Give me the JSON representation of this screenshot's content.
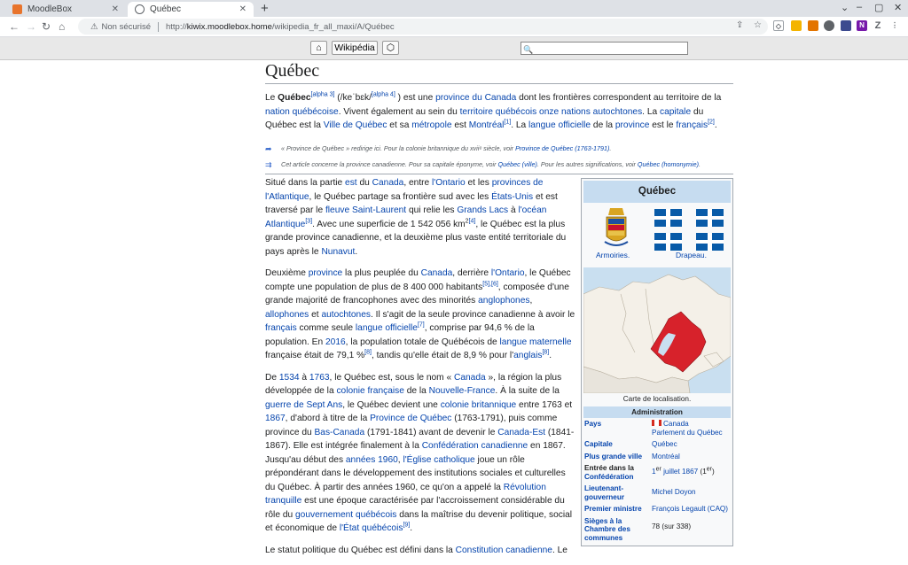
{
  "browser": {
    "tabs": [
      {
        "title": "MoodleBox",
        "active": false
      },
      {
        "title": "Québec",
        "active": true
      }
    ],
    "security_text": "Non sécurisé",
    "url_scheme": "http://",
    "url_host": "kiwix.moodlebox.home",
    "url_path": "/wikipedia_fr_all_maxi/A/Québec"
  },
  "kiwix": {
    "home_icon": "⌂",
    "title_button": "Wikipédia",
    "random_icon": "⬡",
    "search_placeholder": "🔍"
  },
  "article": {
    "title": "Québec",
    "intro": {
      "t1": "Le ",
      "name": "Québec",
      "sup1": "[alpha 3]",
      "t2": " (/ke",
      "ipa": "ˈ",
      "t3": "bɛk/",
      "sup2": "[alpha 4]",
      "t4": " ) est une ",
      "l1": "province du Canada",
      "t5": " dont les frontières correspondent au territoire de la ",
      "l2": "nation québécoise",
      "t6": ". Vivent également au sein du ",
      "l3": "territoire québécois onze nations autochtones",
      "t7": ". La ",
      "l4": "capitale",
      "t8": " du Québec est la ",
      "l5": "Ville de Québec",
      "t9": " et sa ",
      "l6": "métropole",
      "t10": " est ",
      "l7": "Montréal",
      "sup3": "[1]",
      "t11": ". La ",
      "l8": "langue officielle",
      "t12": " de la ",
      "l9": "province",
      "t13": " est le ",
      "l10": "français",
      "sup4": "[2]",
      "t14": "."
    },
    "hatnote1": {
      "t1": "« Province de Québec » redirige ici. Pour la colonie britannique du xviiᵉ siècle, voir ",
      "link": "Province de Québec (1763-1791)",
      "t2": "."
    },
    "hatnote2": {
      "t1": "Cet article concerne la province canadienne. Pour sa capitale éponyme, voir ",
      "l1": "Québec (ville)",
      "t2": ". Pour les autres significations, voir ",
      "l2": "Québec (homonymie)",
      "t3": "."
    },
    "p1": {
      "t1": "Situé dans la partie ",
      "l1": "est",
      "t2": " du ",
      "l2": "Canada",
      "t3": ", entre ",
      "l3": "l'Ontario",
      "t4": " et les ",
      "l4": "provinces de l'Atlantique",
      "t5": ", le Québec partage sa frontière sud avec les ",
      "l5": "États-Unis",
      "t6": " et est traversé par le ",
      "l6": "fleuve Saint-Laurent",
      "t7": " qui relie les ",
      "l7": "Grands Lacs",
      "t8": " à ",
      "l8": "l'océan Atlantique",
      "sup1": "[3]",
      "t9": ". Avec une superficie de 1 542 056 km",
      "sup2": "2",
      "sup3": "[4]",
      "t10": ", le Québec est la plus grande province canadienne, et la deuxième plus vaste entité territoriale du pays après le ",
      "l9": "Nunavut",
      "t11": "."
    },
    "p2": {
      "t1": "Deuxième ",
      "l1": "province",
      "t2": " la plus peuplée du ",
      "l2": "Canada",
      "t3": ", derrière ",
      "l3": "l'Ontario",
      "t4": ", le Québec compte une population de plus de 8 400 000 habitants",
      "sup1": "[5],[6]",
      "t5": ", composée d'une grande majorité de francophones avec des minorités ",
      "l4": "anglophones",
      "t6": ", ",
      "l5": "allophones",
      "t7": " et ",
      "l6": "autochtones",
      "t8": ". Il s'agit de la seule province canadienne à avoir le ",
      "l7": "français",
      "t9": " comme seule ",
      "l8": "langue officielle",
      "sup2": "[7]",
      "t10": ", comprise par 94,6 % de la population. En ",
      "l9": "2016",
      "t11": ", la population totale de Québécois de ",
      "l10": "langue maternelle",
      "t12": " française était de 79,1 %",
      "sup3": "[8]",
      "t13": ", tandis qu'elle était de 8,9 % pour l'",
      "l11": "anglais",
      "sup4": "[8]",
      "t14": "."
    },
    "p3": {
      "t1": "De ",
      "l1": "1534",
      "t2": " à ",
      "l2": "1763",
      "t3": ", le Québec est, sous le nom « ",
      "l3": "Canada",
      "t4": " », la région la plus développée de la ",
      "l4": "colonie française",
      "t5": " de la ",
      "l5": "Nouvelle-France",
      "t6": ". À la suite de la ",
      "l6": "guerre de Sept Ans",
      "t7": ", le Québec devient une ",
      "l7": "colonie britannique",
      "t8": " entre 1763 et ",
      "l8": "1867",
      "t9": ", d'abord à titre de la ",
      "l9": "Province de Québec",
      "t10": " (1763-1791), puis comme province du ",
      "l10": "Bas-Canada",
      "t11": " (1791-1841) avant de devenir le ",
      "l11": "Canada-Est",
      "t12": " (1841-1867). Elle est intégrée finalement à la ",
      "l12": "Confédération canadienne",
      "t13": " en 1867. Jusqu'au début des ",
      "l13": "années 1960",
      "t14": ", ",
      "l14": "l'Église catholique",
      "t15": " joue un rôle prépondérant dans le développement des institutions sociales et culturelles du Québec. À partir des années 1960, ce qu'on a appelé la ",
      "l15": "Révolution tranquille",
      "t16": " est une époque caractérisée par l'accroissement considérable du rôle du ",
      "l16": "gouvernement québécois",
      "t17": " dans la maîtrise du devenir politique, social et économique de ",
      "l17": "l'État québécois",
      "sup1": "[9]",
      "t18": "."
    },
    "p4": {
      "t1": "Le statut politique du Québec est défini dans la ",
      "l1": "Constitution canadienne",
      "t2": ". Le"
    }
  },
  "infobox": {
    "title": "Québec",
    "arms_caption": "Armoiries.",
    "flag_caption": "Drapeau.",
    "map_caption": "Carte de localisation.",
    "section": "Administration",
    "rows": [
      {
        "key": "Pays",
        "value": "Canada",
        "value2": "Parlement du Québec"
      },
      {
        "key": "Capitale",
        "value": "Québec"
      },
      {
        "key": "Plus grande ville",
        "value": "Montréal"
      },
      {
        "key": "Entrée dans la",
        "key2": "Confédération",
        "v_pre": "1",
        "v_sup": "er",
        "v_link": " juillet 1867",
        "v_post": " (1",
        "v_sup2": "er",
        "v_end": ")"
      },
      {
        "key": "Lieutenant-gouverneur",
        "value": "Michel Doyon"
      },
      {
        "key": "Premier ministre",
        "value": "François Legault (CAQ)"
      },
      {
        "key": "Sièges à la Chambre des communes",
        "value": "78 (sur 338)"
      }
    ],
    "colors": {
      "header": "#c6dcf0",
      "flag": "#095ba8",
      "quebec_region": "#d7222b"
    }
  }
}
